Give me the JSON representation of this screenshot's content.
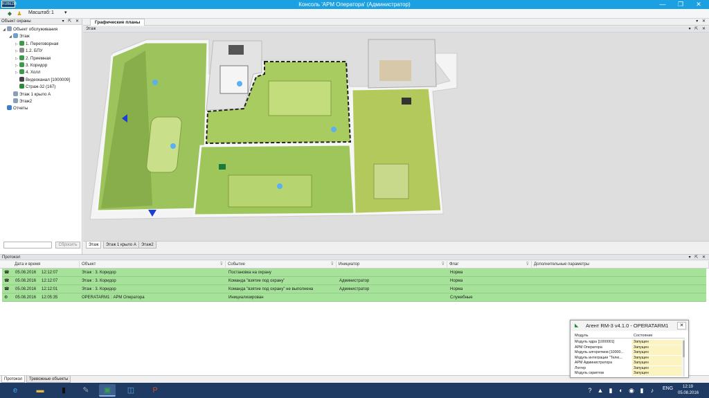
{
  "window": {
    "title": "Консоль 'АРМ Оператора' (Администратор)",
    "logo_text": "RUBEZH",
    "minimize": "—",
    "restore": "❐",
    "close": "✕"
  },
  "toolbar": {
    "scale_label": "Масштаб:",
    "scale_value": "1",
    "caret": "▾"
  },
  "left_panel": {
    "title": "Объект охраны",
    "controls": "▾ ⇱ ✕",
    "tree": [
      {
        "label": "Объект обслуживания",
        "icon": "building-icon",
        "color": "#8aa0b8",
        "indent": 0,
        "expander": "◢"
      },
      {
        "label": "Этаж",
        "icon": "floor-icon",
        "color": "#6fa0c8",
        "indent": 1,
        "expander": "◢"
      },
      {
        "label": "1. Переговорная",
        "icon": "zone-icon",
        "color": "#3a9a4a",
        "indent": 2,
        "expander": "▷"
      },
      {
        "label": "1.2. БПУ",
        "icon": "zone-icon",
        "color": "#8a8a8a",
        "indent": 2,
        "expander": "▷"
      },
      {
        "label": "2. Приемная",
        "icon": "zone-icon",
        "color": "#3a9a4a",
        "indent": 2,
        "expander": "▷"
      },
      {
        "label": "3. Коридор",
        "icon": "zone-icon",
        "color": "#3a9a4a",
        "indent": 2,
        "expander": "▷"
      },
      {
        "label": "4. Холл",
        "icon": "zone-icon",
        "color": "#3a9a4a",
        "indent": 2,
        "expander": "▷"
      },
      {
        "label": "Видеоканал [1000009]",
        "icon": "camera-icon",
        "color": "#444444",
        "indent": 2,
        "expander": ""
      },
      {
        "label": "Страж-32 (167)",
        "icon": "device-icon",
        "color": "#2a8a3a",
        "indent": 2,
        "expander": ""
      },
      {
        "label": "Этаж 1 крыло А",
        "icon": "floor-icon",
        "color": "#8aa0b8",
        "indent": 1,
        "expander": ""
      },
      {
        "label": "Этаж2",
        "icon": "floor-icon",
        "color": "#8aa0b8",
        "indent": 1,
        "expander": ""
      },
      {
        "label": "Отчеты",
        "icon": "reports-icon",
        "color": "#3a7fd0",
        "indent": 0,
        "expander": ""
      }
    ],
    "search_placeholder": "",
    "reset_label": "Сбросить"
  },
  "graphics": {
    "doc_tab": "Графические планы",
    "doc_controls": "▾ ✕",
    "floor_title": "Этаж",
    "floor_controls": "▾ ⇱ ✕",
    "floor_tabs": [
      {
        "label": "Этаж",
        "active": true
      },
      {
        "label": "Этаж 1 крыло А",
        "active": false
      },
      {
        "label": "Этаж2",
        "active": false
      }
    ]
  },
  "protocol": {
    "title": "Протокол",
    "controls": "▾ ⇱ ✕",
    "filter_icon": "⊽",
    "columns": [
      "Дата и время",
      "Объект",
      "Событие",
      "Инициатор",
      "Флаг",
      "Дополнительные параметры"
    ],
    "rows": [
      {
        "icon": "☎",
        "date": "05.08.2016",
        "time": "12:12:07",
        "object": "Этаж : 3. Коридор",
        "event": "Постановка на охрану",
        "initiator": "",
        "flag": "Норма",
        "extra": ""
      },
      {
        "icon": "☎",
        "date": "05.08.2016",
        "time": "12:12:07",
        "object": "Этаж : 3. Коридор",
        "event": "Команда \"взятие под охрану\"",
        "initiator": "Администратор",
        "flag": "Норма",
        "extra": ""
      },
      {
        "icon": "☎",
        "date": "05.08.2016",
        "time": "12:12:01",
        "object": "Этаж : 3. Коридор",
        "event": "Команда \"взятие под охрану\" не выполнена",
        "initiator": "Администратор",
        "flag": "Норма",
        "extra": ""
      },
      {
        "icon": "⚙",
        "date": "05.08.2016",
        "time": "12:05:35",
        "object": "OPERATARM1 : АРМ Оператора",
        "event": "Инициализирован",
        "initiator": "",
        "flag": "Служебные",
        "extra": ""
      }
    ]
  },
  "bottom_tabs": [
    {
      "label": "Протокол",
      "active": true
    },
    {
      "label": "Тревожные объекты",
      "active": false
    }
  ],
  "agent": {
    "title": "Агент RM-3 v4.1.0 - OPERATARM1",
    "close": "✕",
    "col_module": "Модуль",
    "col_state": "Состояние",
    "rows": [
      {
        "module": "Модуль ядра [1000001]",
        "state": "Запущен"
      },
      {
        "module": "АРМ Оператора",
        "state": "Запущен"
      },
      {
        "module": "Модуль алгоритмов [10000...",
        "state": "Запущен"
      },
      {
        "module": "Модуль интеграции \"Телю...",
        "state": "Запущен"
      },
      {
        "module": "АРМ Администратора",
        "state": "Запущен"
      },
      {
        "module": "Логгер",
        "state": "Запущен"
      },
      {
        "module": "Модуль скриптов",
        "state": "Запущен"
      }
    ]
  },
  "taskbar": {
    "apps": [
      {
        "name": "ie-icon",
        "glyph": "e",
        "active": false
      },
      {
        "name": "explorer-icon",
        "glyph": "▬",
        "active": false
      },
      {
        "name": "console-icon",
        "glyph": "▮",
        "active": false
      },
      {
        "name": "tools-icon",
        "glyph": "✎",
        "active": false
      },
      {
        "name": "arm-operator-icon",
        "glyph": "▣",
        "active": true
      },
      {
        "name": "admin-icon",
        "glyph": "◫",
        "active": false
      },
      {
        "name": "powerpoint-icon",
        "glyph": "P",
        "active": false
      }
    ],
    "lang": "ENG",
    "time": "12:19",
    "date": "05.08.2016",
    "tray": [
      "?",
      "▲",
      "▮",
      "◐",
      "◉",
      "▮",
      "♪"
    ]
  }
}
